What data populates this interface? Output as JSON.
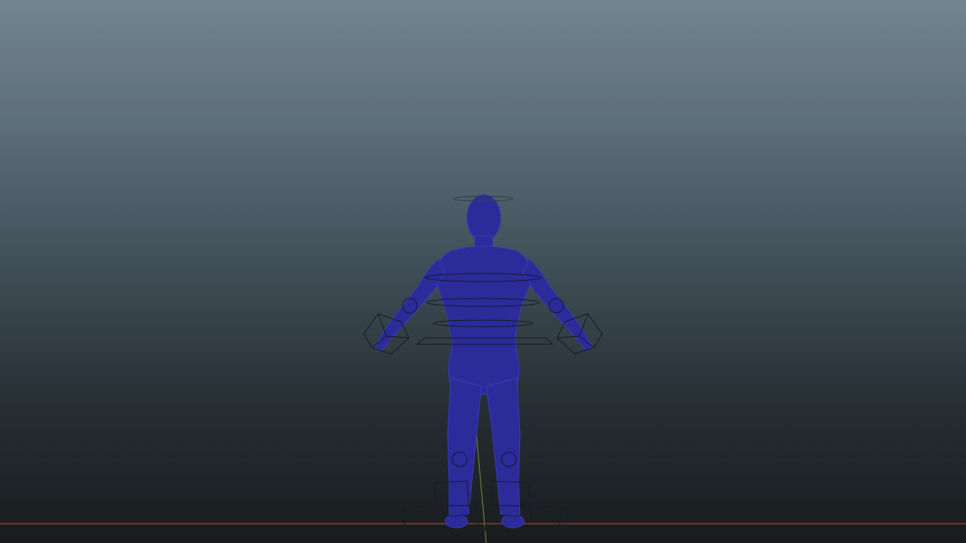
{
  "viewport": {
    "background_top": "#72848f",
    "background_bottom": "#191c1e"
  },
  "grid": {
    "x_axis_color": "#b5443a",
    "z_axis_color": "#6b8f2e"
  },
  "character": {
    "mesh_color": "#2b2b9a",
    "mesh_edge_color": "#3a3ab8",
    "rig_control_color": "#1a1a2a",
    "pose": "T-pose"
  }
}
